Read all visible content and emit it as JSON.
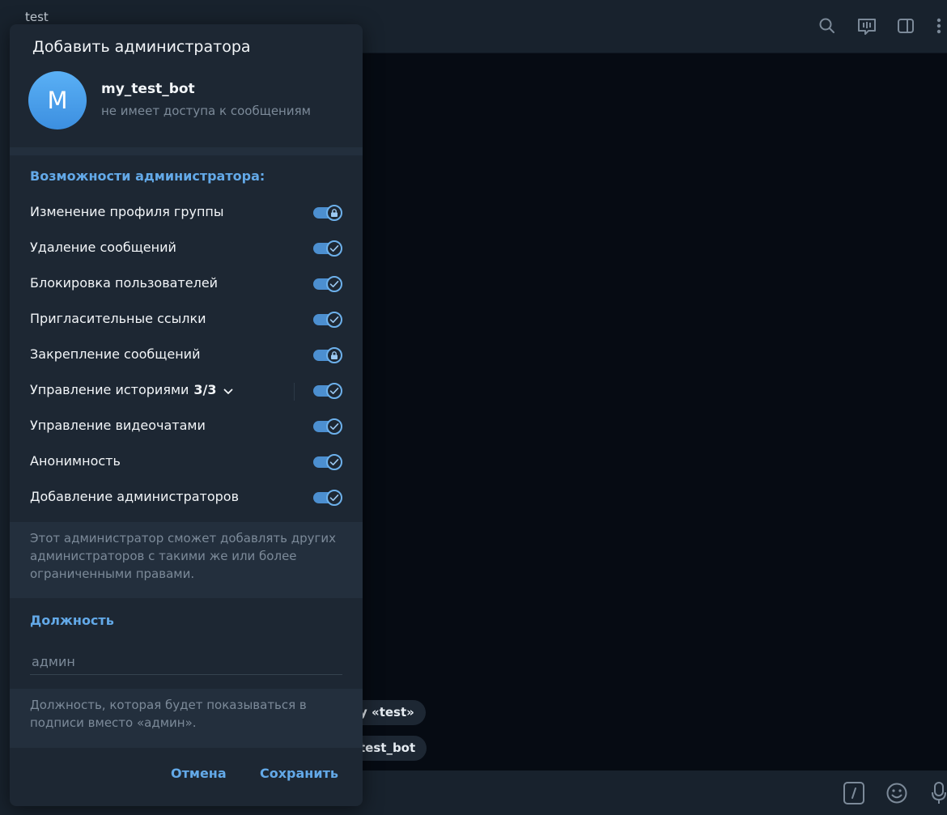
{
  "app": {
    "chat_title": "test",
    "service_messages": [
      "у «test»",
      "test_bot"
    ]
  },
  "modal": {
    "title": "Добавить администратора",
    "avatar_letter": "M",
    "bot_name": "my_test_bot",
    "bot_status": "не имеет доступа к сообщениям",
    "rights_header": "Возможности администратора:",
    "permissions": [
      {
        "label": "Изменение профиля группы",
        "state": "locked"
      },
      {
        "label": "Удаление сообщений",
        "state": "on"
      },
      {
        "label": "Блокировка пользователей",
        "state": "on"
      },
      {
        "label": "Пригласительные ссылки",
        "state": "on"
      },
      {
        "label": "Закрепление сообщений",
        "state": "locked"
      },
      {
        "label": "Управление историями",
        "count": "3/3",
        "state": "on"
      },
      {
        "label": "Управление видеочатами",
        "state": "on"
      },
      {
        "label": "Анонимность",
        "state": "on"
      },
      {
        "label": "Добавление администраторов",
        "state": "on"
      }
    ],
    "admins_note": "Этот администратор сможет добавлять других администраторов с такими же или более ограниченными правами.",
    "title_header": "Должность",
    "title_placeholder": "админ",
    "title_note": "Должность, которая будет показываться в подписи вместо «админ».",
    "cancel": "Отмена",
    "save": "Сохранить"
  },
  "colors": {
    "accent": "#63a9e8",
    "toggle_on": "#4c8fd0",
    "modal_bg": "#1d2733",
    "band_bg": "#232f3d"
  },
  "icons": [
    "search-icon",
    "video-chat-icon",
    "sidebar-toggle-icon",
    "more-icon",
    "commands-icon",
    "emoji-icon",
    "microphone-icon",
    "lock-icon",
    "check-icon",
    "chevron-down-icon"
  ]
}
